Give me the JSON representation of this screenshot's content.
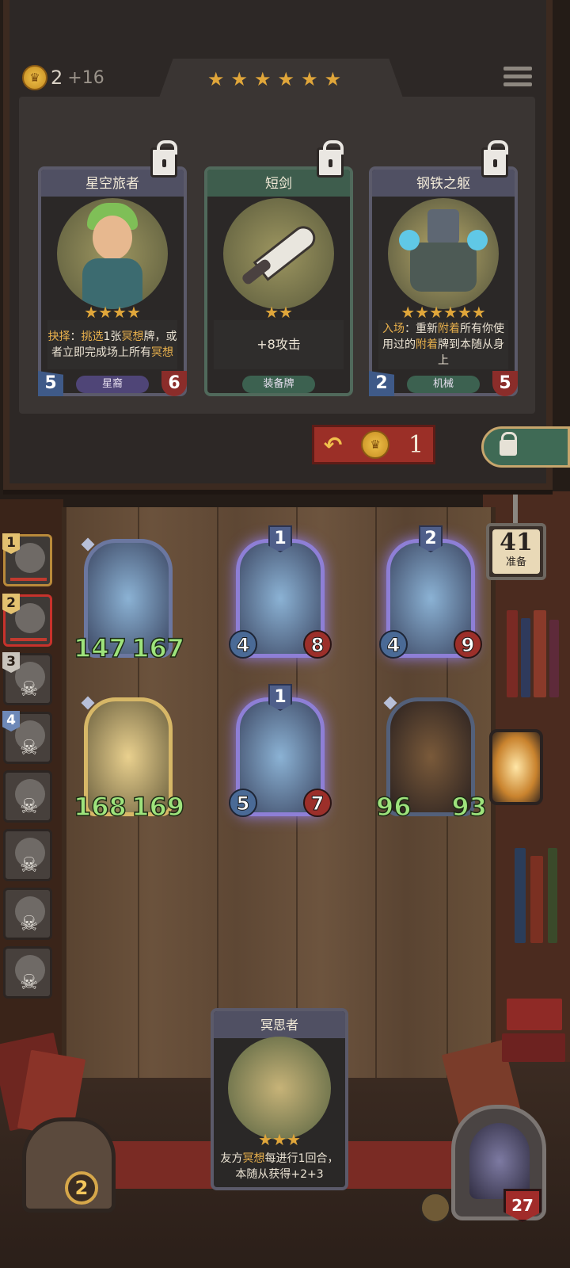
{
  "shop": {
    "gold": "2",
    "gold_income": "+16",
    "tier_stars": 6,
    "reroll_cost": "1",
    "cards": [
      {
        "name": "星空旅者",
        "stars": 4,
        "text_parts": [
          [
            "抉择",
            true
          ],
          [
            "：",
            false
          ],
          [
            "挑选",
            true
          ],
          [
            "1张",
            false
          ],
          [
            "冥想",
            true
          ],
          [
            "牌，或者立即完成场上所有",
            false
          ],
          [
            "冥想",
            true
          ]
        ],
        "tribe": "星裔",
        "attack": "5",
        "health": "6"
      },
      {
        "name": "短剑",
        "stars": 2,
        "text_parts": [
          [
            "+8攻击",
            false
          ]
        ],
        "tribe": "装备牌",
        "attack": "",
        "health": ""
      },
      {
        "name": "钢铁之躯",
        "stars": 6,
        "text_parts": [
          [
            "入场",
            true
          ],
          [
            "：重新",
            false
          ],
          [
            "附着",
            true
          ],
          [
            "所有你使用过的",
            false
          ],
          [
            "附着",
            true
          ],
          [
            "牌到本随从身上",
            false
          ]
        ],
        "tribe": "机械",
        "attack": "2",
        "health": "5"
      }
    ]
  },
  "opponents": [
    {
      "rank": "1",
      "style": "gold",
      "alive": true
    },
    {
      "rank": "2",
      "style": "red",
      "alive": true
    },
    {
      "rank": "3",
      "style": "gray",
      "alive": false
    },
    {
      "rank": "4",
      "style": "blue",
      "alive": false
    },
    {
      "rank": "",
      "style": "",
      "alive": false
    },
    {
      "rank": "",
      "style": "",
      "alive": false
    },
    {
      "rank": "",
      "style": "",
      "alive": false
    },
    {
      "rank": "",
      "style": "",
      "alive": false
    }
  ],
  "board": [
    {
      "attack": "147",
      "health": "167",
      "tier": "",
      "style": "blue"
    },
    {
      "attack": "4",
      "health": "8",
      "tier": "1",
      "style": "purple"
    },
    {
      "attack": "4",
      "health": "9",
      "tier": "2",
      "style": "purple"
    },
    {
      "attack": "168",
      "health": "169",
      "tier": "",
      "style": "gold"
    },
    {
      "attack": "5",
      "health": "7",
      "tier": "1",
      "style": "purple"
    },
    {
      "attack": "96",
      "health": "93",
      "tier": "",
      "style": "dark"
    }
  ],
  "turn": {
    "number": "41",
    "label": "准备"
  },
  "hand": {
    "name": "冥思者",
    "stars": 3,
    "text_parts": [
      [
        "友方",
        false
      ],
      [
        "冥想",
        true
      ],
      [
        "每进行1回合，本随从获得+2+3",
        false
      ]
    ]
  },
  "player": {
    "level": "2",
    "health": "27"
  },
  "colors": {
    "accent_gold": "#e0a63a",
    "highlight_text": "#e8b04c",
    "buff_green": "#9ee37c",
    "reroll_red": "#9b2f27"
  }
}
